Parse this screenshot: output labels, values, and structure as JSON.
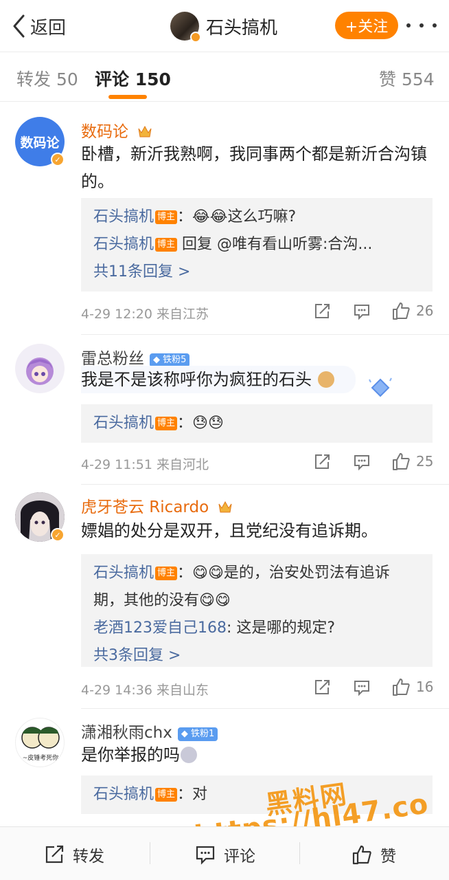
{
  "nav": {
    "back_label": "返回",
    "user_name": "石头搞机",
    "follow_label": "+关注"
  },
  "tabs": {
    "repost_label": "转发",
    "repost_count": "50",
    "comment_label": "评论",
    "comment_count": "150",
    "like_label": "赞",
    "like_count": "554"
  },
  "colors": {
    "accent": "#ff8200",
    "link": "#4a6a9f",
    "vip_name": "#e86b0e"
  },
  "comments": [
    {
      "username": "数码论",
      "avatar_text": "数码论",
      "text": "卧槽，新沂我熟啊，我同事两个都是新沂合沟镇的。",
      "replies": [
        {
          "name": "石头搞机",
          "tag": "博主",
          "text": "：😂😂这么巧嘛?"
        },
        {
          "name": "石头搞机",
          "tag": "博主",
          "text": " 回复 @唯有看山听雾:合沟..."
        }
      ],
      "more_replies": "共11条回复 >",
      "time": "4-29 12:20",
      "source": "来自江苏",
      "likes": "26"
    },
    {
      "username": "雷总粉丝",
      "fan_badge": "铁粉5",
      "text": "我是不是该称呼你为疯狂的石头",
      "replies": [
        {
          "name": "石头搞机",
          "tag": "博主",
          "text": "：😓😓"
        }
      ],
      "time": "4-29 11:51",
      "source": "来自河北",
      "likes": "25"
    },
    {
      "username": "虎牙苍云 Ricardo",
      "text": "嫖娼的处分是双开，且党纪没有追诉期。",
      "replies": [
        {
          "name": "石头搞机",
          "tag": "博主",
          "text": "：😋😋是的，治安处罚法有追诉"
        },
        {
          "name": "",
          "tag": "",
          "text": "期，其他的没有😋😋"
        },
        {
          "name": "老酒123爱自己168",
          "tag": "",
          "text": ": 这是哪的规定?"
        }
      ],
      "more_replies": "共3条回复 >",
      "time": "4-29 14:36",
      "source": "来自山东",
      "likes": "16"
    },
    {
      "username": "潇湘秋雨chx",
      "fan_badge": "铁粉1",
      "avatar_caption": "~皮锤考死你",
      "text": "是你举报的吗",
      "replies": [
        {
          "name": "石头搞机",
          "tag": "博主",
          "text": "：对"
        }
      ]
    }
  ],
  "watermark": {
    "line1": "黑料网",
    "line2": "https://hl47.co"
  },
  "bottom_bar": {
    "repost": "转发",
    "comment": "评论",
    "like": "赞"
  }
}
